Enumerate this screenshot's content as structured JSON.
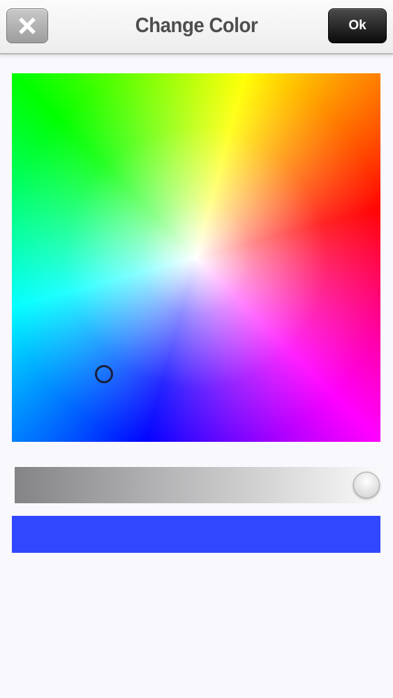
{
  "header": {
    "title": "Change Color",
    "ok_label": "Ok",
    "close_icon": "close-icon"
  },
  "picker": {
    "type": "hue-saturation-wheel-square"
  },
  "brightness_slider": {
    "value_fraction": 1.0,
    "gradient_start": "#848386",
    "gradient_end": "#fafafa"
  },
  "preview": {
    "color": "#3047ff"
  }
}
